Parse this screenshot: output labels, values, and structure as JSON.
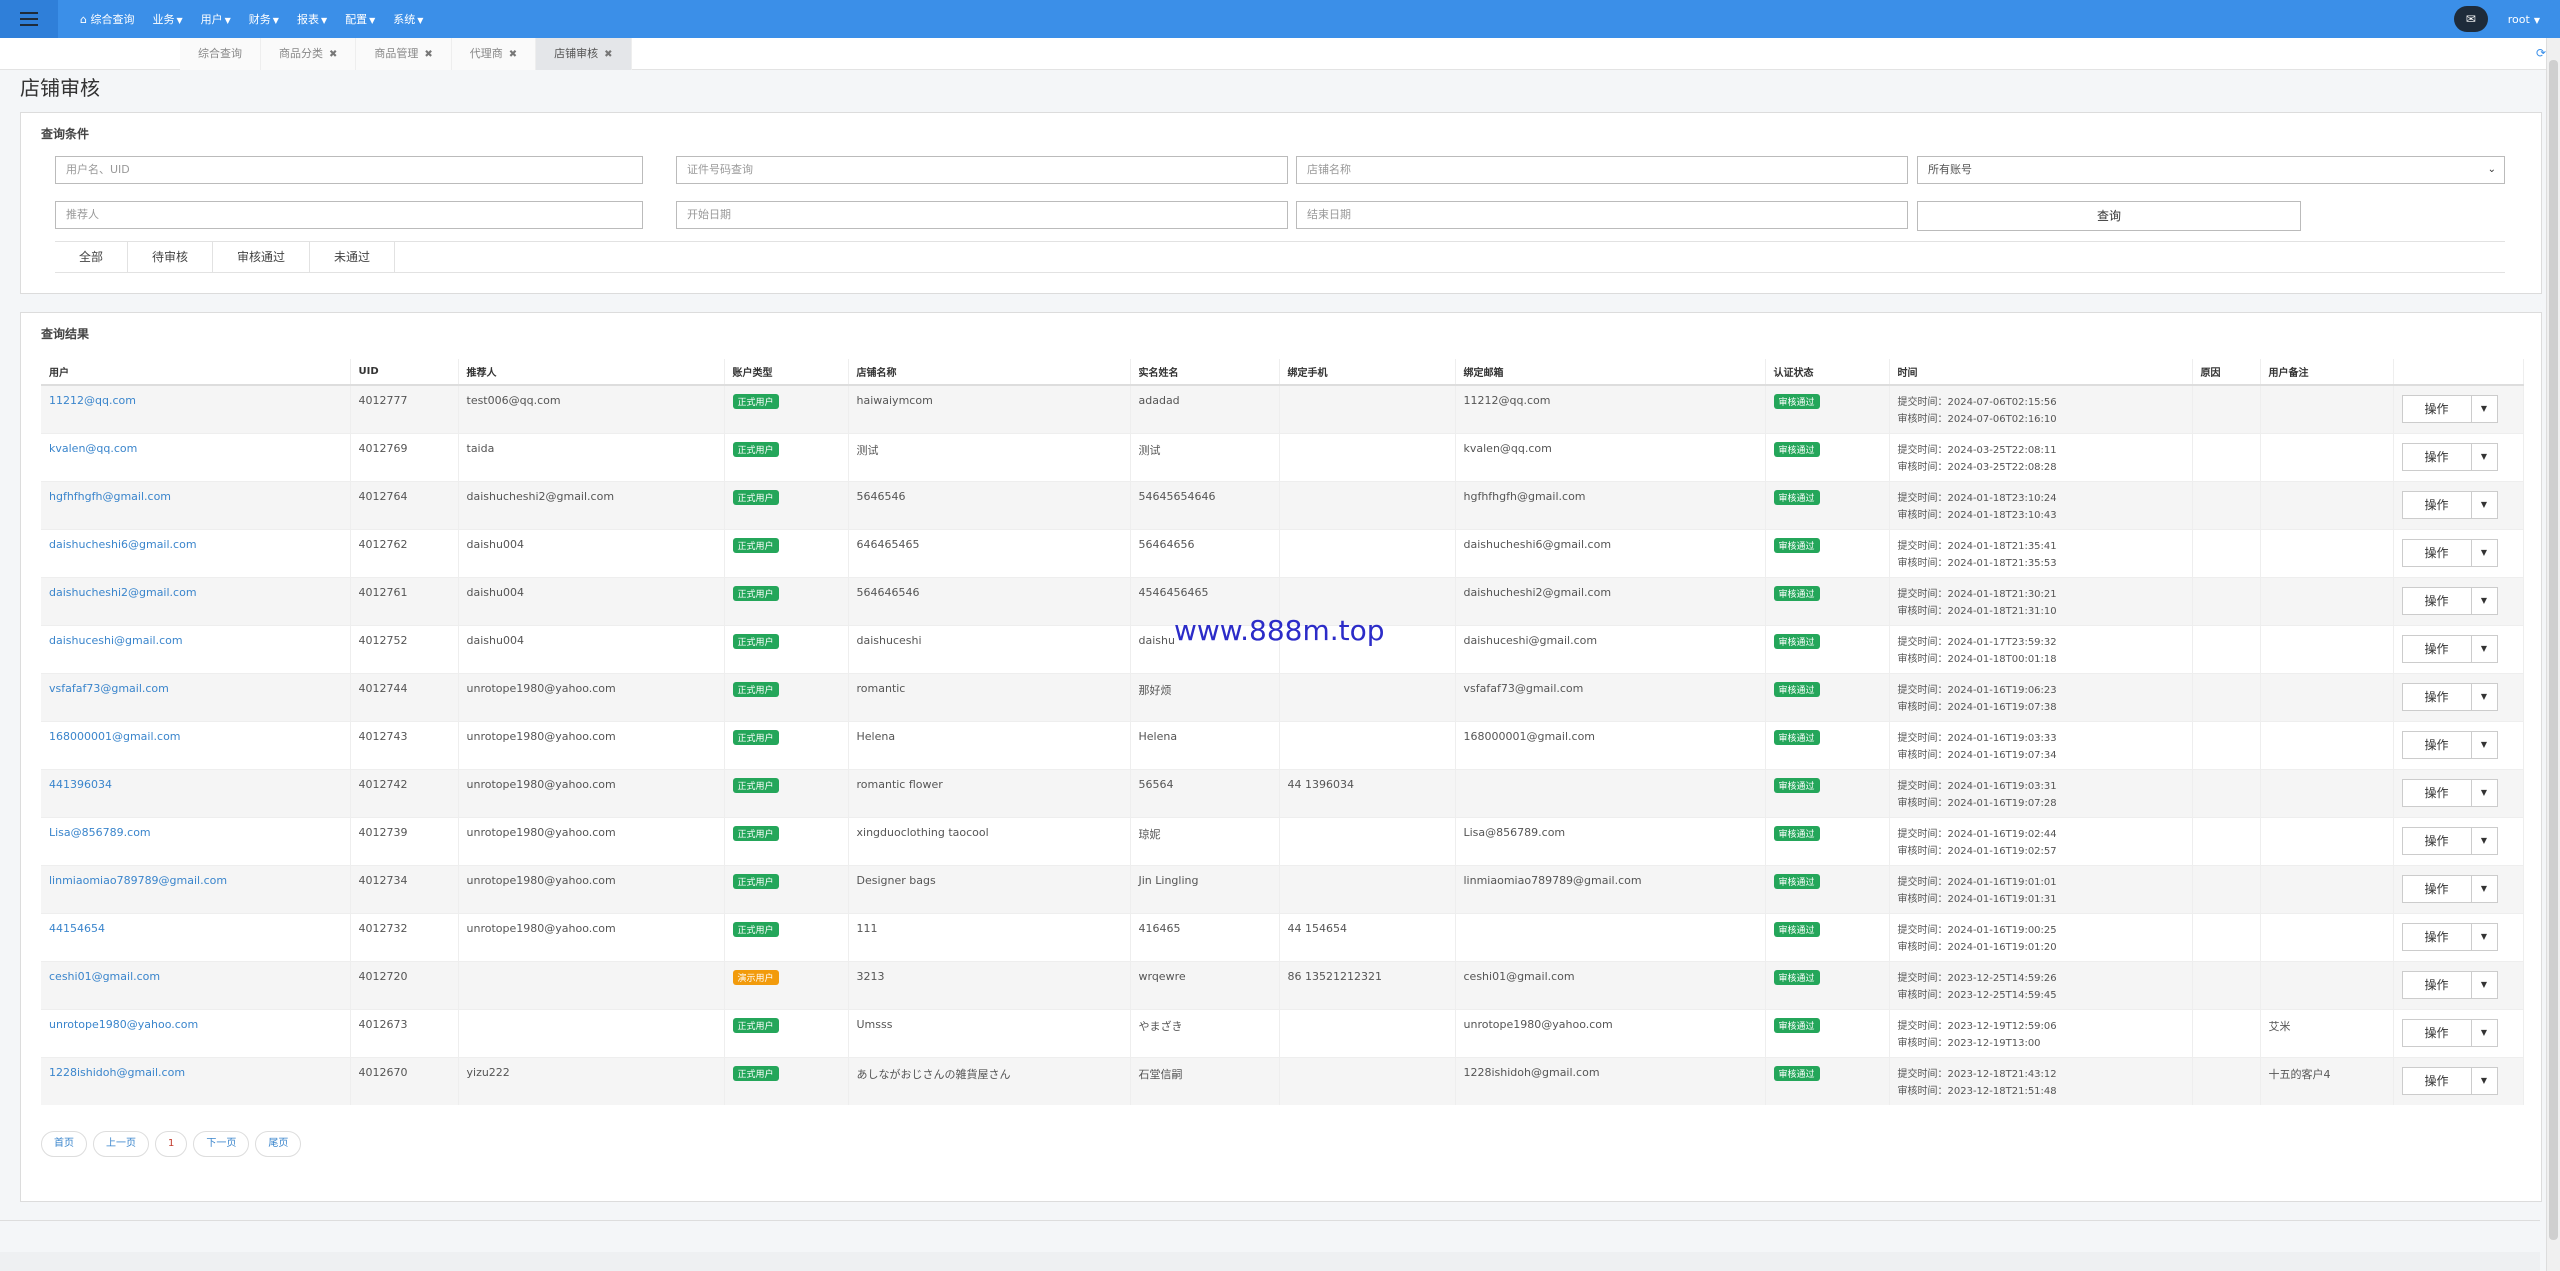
{
  "nav": {
    "items": [
      {
        "label": "综合查询",
        "icon": "home-icon"
      },
      {
        "label": "业务"
      },
      {
        "label": "用户"
      },
      {
        "label": "财务"
      },
      {
        "label": "报表"
      },
      {
        "label": "配置"
      },
      {
        "label": "系统"
      }
    ],
    "user": "root"
  },
  "tabs": [
    {
      "label": "综合查询",
      "closable": false
    },
    {
      "label": "商品分类",
      "closable": true
    },
    {
      "label": "商品管理",
      "closable": true
    },
    {
      "label": "代理商",
      "closable": true
    },
    {
      "label": "店铺审核",
      "closable": true,
      "active": true
    }
  ],
  "page": {
    "title": "店铺审核"
  },
  "query": {
    "title": "查询条件",
    "user_placeholder": "用户名、UID",
    "cert_placeholder": "证件号码查询",
    "shop_placeholder": "店铺名称",
    "account_select": "所有账号",
    "referrer_placeholder": "推荐人",
    "start_placeholder": "开始日期",
    "end_placeholder": "结束日期",
    "search_label": "查询",
    "status_tabs": [
      "全部",
      "待审核",
      "审核通过",
      "未通过"
    ]
  },
  "results": {
    "title": "查询结果",
    "columns": [
      "用户",
      "UID",
      "推荐人",
      "账户类型",
      "店铺名称",
      "实名姓名",
      "绑定手机",
      "绑定邮箱",
      "认证状态",
      "时间",
      "原因",
      "用户备注",
      ""
    ],
    "submit_prefix": "提交时间：",
    "review_prefix": "审核时间：",
    "op_label": "操作",
    "rows": [
      {
        "user": "11212@qq.com",
        "uid": "4012777",
        "referrer": "test006@qq.com",
        "type": "正式用户",
        "demo": false,
        "shop": "haiwaiymcom",
        "name": "adadad",
        "phone": "",
        "email": "11212@qq.com",
        "status": "审核通过",
        "submit": "2024-07-06T02:15:56",
        "review": "2024-07-06T02:16:10",
        "reason": "",
        "note": ""
      },
      {
        "user": "kvalen@qq.com",
        "uid": "4012769",
        "referrer": "taida",
        "type": "正式用户",
        "demo": false,
        "shop": "测试",
        "name": "测试",
        "phone": "",
        "email": "kvalen@qq.com",
        "status": "审核通过",
        "submit": "2024-03-25T22:08:11",
        "review": "2024-03-25T22:08:28",
        "reason": "",
        "note": ""
      },
      {
        "user": "hgfhfhgfh@gmail.com",
        "uid": "4012764",
        "referrer": "daishucheshi2@gmail.com",
        "type": "正式用户",
        "demo": false,
        "shop": "5646546",
        "name": "54645654646",
        "phone": "",
        "email": "hgfhfhgfh@gmail.com",
        "status": "审核通过",
        "submit": "2024-01-18T23:10:24",
        "review": "2024-01-18T23:10:43",
        "reason": "",
        "note": ""
      },
      {
        "user": "daishucheshi6@gmail.com",
        "uid": "4012762",
        "referrer": "daishu004",
        "type": "正式用户",
        "demo": false,
        "shop": "646465465",
        "name": "56464656",
        "phone": "",
        "email": "daishucheshi6@gmail.com",
        "status": "审核通过",
        "submit": "2024-01-18T21:35:41",
        "review": "2024-01-18T21:35:53",
        "reason": "",
        "note": ""
      },
      {
        "user": "daishucheshi2@gmail.com",
        "uid": "4012761",
        "referrer": "daishu004",
        "type": "正式用户",
        "demo": false,
        "shop": "564646546",
        "name": "4546456465",
        "phone": "",
        "email": "daishucheshi2@gmail.com",
        "status": "审核通过",
        "submit": "2024-01-18T21:30:21",
        "review": "2024-01-18T21:31:10",
        "reason": "",
        "note": ""
      },
      {
        "user": "daishuceshi@gmail.com",
        "uid": "4012752",
        "referrer": "daishu004",
        "type": "正式用户",
        "demo": false,
        "shop": "daishuceshi",
        "name": "daishu",
        "phone": "",
        "email": "daishuceshi@gmail.com",
        "status": "审核通过",
        "submit": "2024-01-17T23:59:32",
        "review": "2024-01-18T00:01:18",
        "reason": "",
        "note": ""
      },
      {
        "user": "vsfafaf73@gmail.com",
        "uid": "4012744",
        "referrer": "unrotope1980@yahoo.com",
        "type": "正式用户",
        "demo": false,
        "shop": "romantic",
        "name": "那好烦",
        "phone": "",
        "email": "vsfafaf73@gmail.com",
        "status": "审核通过",
        "submit": "2024-01-16T19:06:23",
        "review": "2024-01-16T19:07:38",
        "reason": "",
        "note": ""
      },
      {
        "user": "168000001@gmail.com",
        "uid": "4012743",
        "referrer": "unrotope1980@yahoo.com",
        "type": "正式用户",
        "demo": false,
        "shop": "Helena",
        "name": "Helena",
        "phone": "",
        "email": "168000001@gmail.com",
        "status": "审核通过",
        "submit": "2024-01-16T19:03:33",
        "review": "2024-01-16T19:07:34",
        "reason": "",
        "note": ""
      },
      {
        "user": "441396034",
        "uid": "4012742",
        "referrer": "unrotope1980@yahoo.com",
        "type": "正式用户",
        "demo": false,
        "shop": "romantic flower",
        "name": "56564",
        "phone": "44 1396034",
        "email": "",
        "status": "审核通过",
        "submit": "2024-01-16T19:03:31",
        "review": "2024-01-16T19:07:28",
        "reason": "",
        "note": ""
      },
      {
        "user": "Lisa@856789.com",
        "uid": "4012739",
        "referrer": "unrotope1980@yahoo.com",
        "type": "正式用户",
        "demo": false,
        "shop": "xingduoclothing taocool",
        "name": "琼妮",
        "phone": "",
        "email": "Lisa@856789.com",
        "status": "审核通过",
        "submit": "2024-01-16T19:02:44",
        "review": "2024-01-16T19:02:57",
        "reason": "",
        "note": ""
      },
      {
        "user": "linmiaomiao789789@gmail.com",
        "uid": "4012734",
        "referrer": "unrotope1980@yahoo.com",
        "type": "正式用户",
        "demo": false,
        "shop": "Designer bags",
        "name": "Jin Lingling",
        "phone": "",
        "email": "linmiaomiao789789@gmail.com",
        "status": "审核通过",
        "submit": "2024-01-16T19:01:01",
        "review": "2024-01-16T19:01:31",
        "reason": "",
        "note": ""
      },
      {
        "user": "44154654",
        "uid": "4012732",
        "referrer": "unrotope1980@yahoo.com",
        "type": "正式用户",
        "demo": false,
        "shop": "111",
        "name": "416465",
        "phone": "44 154654",
        "email": "",
        "status": "审核通过",
        "submit": "2024-01-16T19:00:25",
        "review": "2024-01-16T19:01:20",
        "reason": "",
        "note": ""
      },
      {
        "user": "ceshi01@gmail.com",
        "uid": "4012720",
        "referrer": "",
        "type": "演示用户",
        "demo": true,
        "shop": "3213",
        "name": "wrqewre",
        "phone": "86 13521212321",
        "email": "ceshi01@gmail.com",
        "status": "审核通过",
        "submit": "2023-12-25T14:59:26",
        "review": "2023-12-25T14:59:45",
        "reason": "",
        "note": ""
      },
      {
        "user": "unrotope1980@yahoo.com",
        "uid": "4012673",
        "referrer": "",
        "type": "正式用户",
        "demo": false,
        "shop": "Umsss",
        "name": "やまざき",
        "phone": "",
        "email": "unrotope1980@yahoo.com",
        "status": "审核通过",
        "submit": "2023-12-19T12:59:06",
        "review": "2023-12-19T13:00",
        "reason": "",
        "note": "艾米"
      },
      {
        "user": "1228ishidoh@gmail.com",
        "uid": "4012670",
        "referrer": "yizu222",
        "type": "正式用户",
        "demo": false,
        "shop": "あしながおじさんの雑貨屋さん",
        "name": "石堂信嗣",
        "phone": "",
        "email": "1228ishidoh@gmail.com",
        "status": "审核通过",
        "submit": "2023-12-18T21:43:12",
        "review": "2023-12-18T21:51:48",
        "reason": "",
        "note": "十五的客户4"
      }
    ]
  },
  "pager": {
    "first": "首页",
    "prev": "上一页",
    "current": "1",
    "next": "下一页",
    "last": "尾页"
  },
  "watermark": "www.888m.top"
}
